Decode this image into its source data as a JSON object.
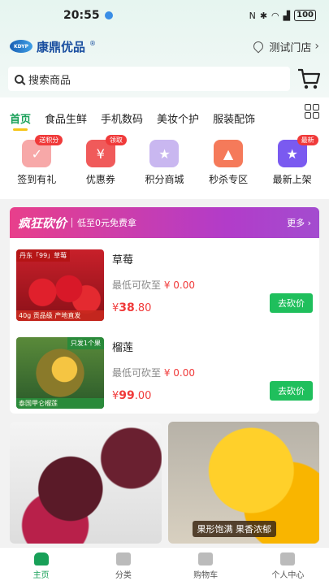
{
  "status": {
    "time": "20:55",
    "battery": "100"
  },
  "header": {
    "logo_mark": "KDYP",
    "logo_text": "康鼎优品",
    "logo_reg": "®",
    "store": "测试门店",
    "chevron": "›"
  },
  "search": {
    "placeholder": "搜索商品"
  },
  "tabs": [
    "首页",
    "食品生鲜",
    "手机数码",
    "美妆个护",
    "服装配饰"
  ],
  "quick": [
    {
      "label": "签到有礼",
      "badge": "送积分",
      "color": "#f7a8a8"
    },
    {
      "label": "优惠券",
      "badge": "领取",
      "color": "#f05a5a"
    },
    {
      "label": "积分商城",
      "badge": "",
      "color": "#c9b7f0"
    },
    {
      "label": "秒杀专区",
      "badge": "",
      "color": "#f57a5a"
    },
    {
      "label": "最新上架",
      "badge": "最新",
      "color": "#7a5af0"
    }
  ],
  "bargain": {
    "title": "疯狂砍价",
    "subtitle": "低至0元免费拿",
    "more": "更多 ›",
    "products": [
      {
        "name": "草莓",
        "min_label": "最低可砍至",
        "min_price": "¥ 0.00",
        "currency": "¥",
        "price_int": "38",
        "price_dec": ".80",
        "button": "去砍价",
        "img_tag": "丹东「99」草莓",
        "img_foot": "40g 贡品级 产地直发"
      },
      {
        "name": "榴莲",
        "min_label": "最低可砍至",
        "min_price": "¥ 0.00",
        "currency": "¥",
        "price_int": "99",
        "price_dec": ".00",
        "button": "去砍价",
        "img_tag": "只发1个果",
        "img_foot": "泰国甲仑榴莲"
      }
    ]
  },
  "cards": {
    "right_caption": "果形饱满 果香浓郁"
  },
  "tabbar": [
    "主页",
    "分类",
    "购物车",
    "个人中心"
  ]
}
